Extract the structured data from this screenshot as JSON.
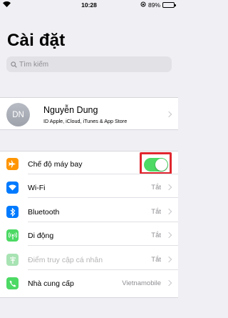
{
  "status_bar": {
    "time": "10:28",
    "battery": "89%",
    "battery_level": 0.89
  },
  "page": {
    "title": "Cài đặt"
  },
  "search": {
    "placeholder": "Tìm kiếm"
  },
  "profile": {
    "initials": "DN",
    "name": "Nguyễn Dung",
    "subtitle": "ID Apple, iCloud, iTunes & App Store"
  },
  "settings": [
    {
      "label": "Chế độ máy bay",
      "icon": "airplane-icon",
      "color": "#ff9500",
      "toggle_on": true
    },
    {
      "label": "Wi-Fi",
      "icon": "wifi-icon",
      "color": "#007aff",
      "value": "Tắt"
    },
    {
      "label": "Bluetooth",
      "icon": "bluetooth-icon",
      "color": "#007aff",
      "value": "Tắt"
    },
    {
      "label": "Di động",
      "icon": "cellular-icon",
      "color": "#4cd964",
      "value": "Tắt"
    },
    {
      "label": "Điểm truy cập cá nhân",
      "icon": "hotspot-icon",
      "color": "#a8e3b3",
      "value": "Tắt",
      "disabled": true
    },
    {
      "label": "Nhà cung cấp",
      "icon": "phone-icon",
      "color": "#4cd964",
      "value": "Vietnamobile"
    }
  ],
  "colors": {
    "toggle_on": "#4cd964",
    "highlight_box": "#e0262f",
    "background": "#efeff4"
  }
}
